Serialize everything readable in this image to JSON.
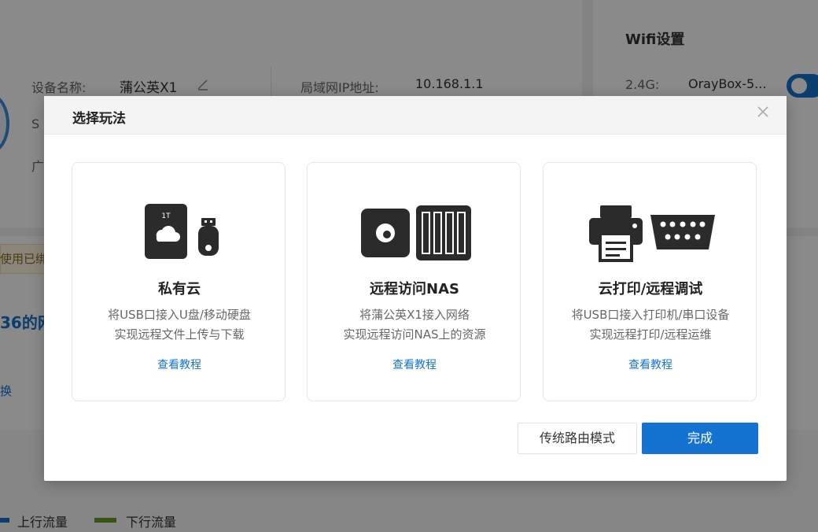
{
  "background": {
    "device": {
      "name_label": "设备名称:",
      "name_value": "蒲公英X1",
      "sn_label_partial": "S",
      "extra_label_partial": "广"
    },
    "lan": {
      "ip_label": "局域网IP地址:",
      "ip_value": "10.168.1.1"
    },
    "wifi": {
      "title": "Wifi设置",
      "band_label": "2.4G:",
      "ssid": "OrayBox-5..."
    },
    "notice_partial": "使用已绑",
    "network_title_partial": "36的网",
    "switch_partial": "换",
    "legend": {
      "upload": "上行流量",
      "download": "下行流量",
      "upload_color": "#1473d0",
      "download_color": "#6a9a2a"
    }
  },
  "modal": {
    "title": "选择玩法",
    "close_icon": "close-icon",
    "cards": [
      {
        "title": "私有云",
        "desc_line1": "将USB口接入U盘/移动硬盘",
        "desc_line2": "实现远程文件上传与下载",
        "link": "查看教程",
        "icon": "cloud-storage-icon",
        "icon_text": "1T"
      },
      {
        "title": "远程访问NAS",
        "desc_line1": "将蒲公英X1接入网络",
        "desc_line2": "实现远程访问NAS上的资源",
        "link": "查看教程",
        "icon": "nas-icon"
      },
      {
        "title": "云打印/远程调试",
        "desc_line1": "将USB口接入打印机/串口设备",
        "desc_line2": "实现远程打印/远程运维",
        "link": "查看教程",
        "icon": "printer-serial-icon"
      }
    ],
    "buttons": {
      "secondary": "传统路由模式",
      "primary": "完成"
    },
    "accent_color": "#1473d0"
  }
}
